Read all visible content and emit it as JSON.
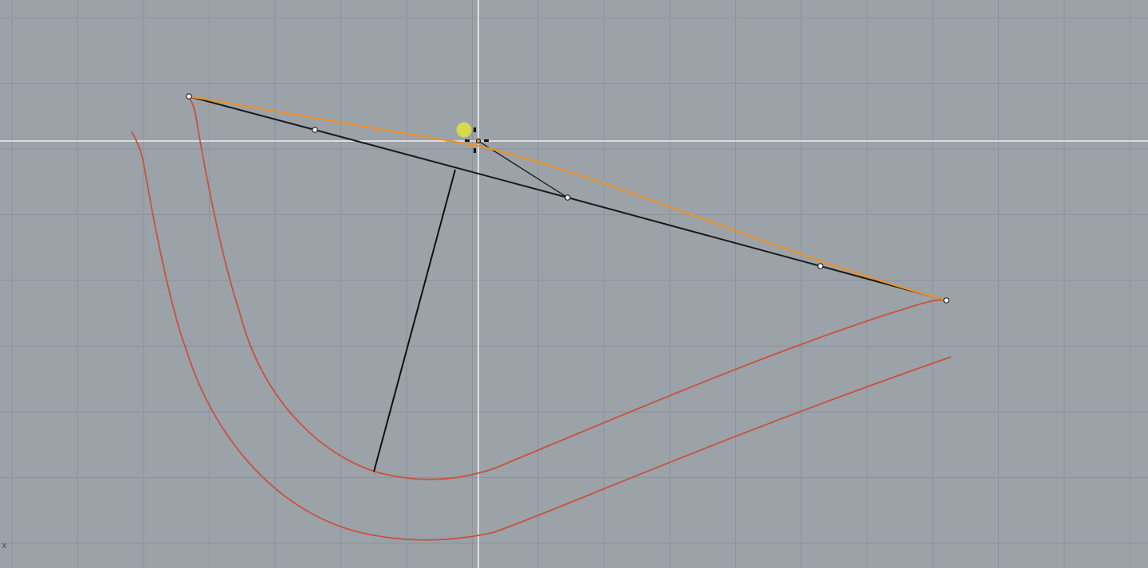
{
  "viewport": {
    "axis_label": "x",
    "background_color": "#9ba2a8",
    "grid_color": "#8c939a",
    "crosshair_color": "#ffffff",
    "curve_color": "#c9523f",
    "edit_curve_color": "#e8922f",
    "control_polygon_color": "#1a1a1a",
    "cursor_highlight_color": "#e2e33a"
  }
}
